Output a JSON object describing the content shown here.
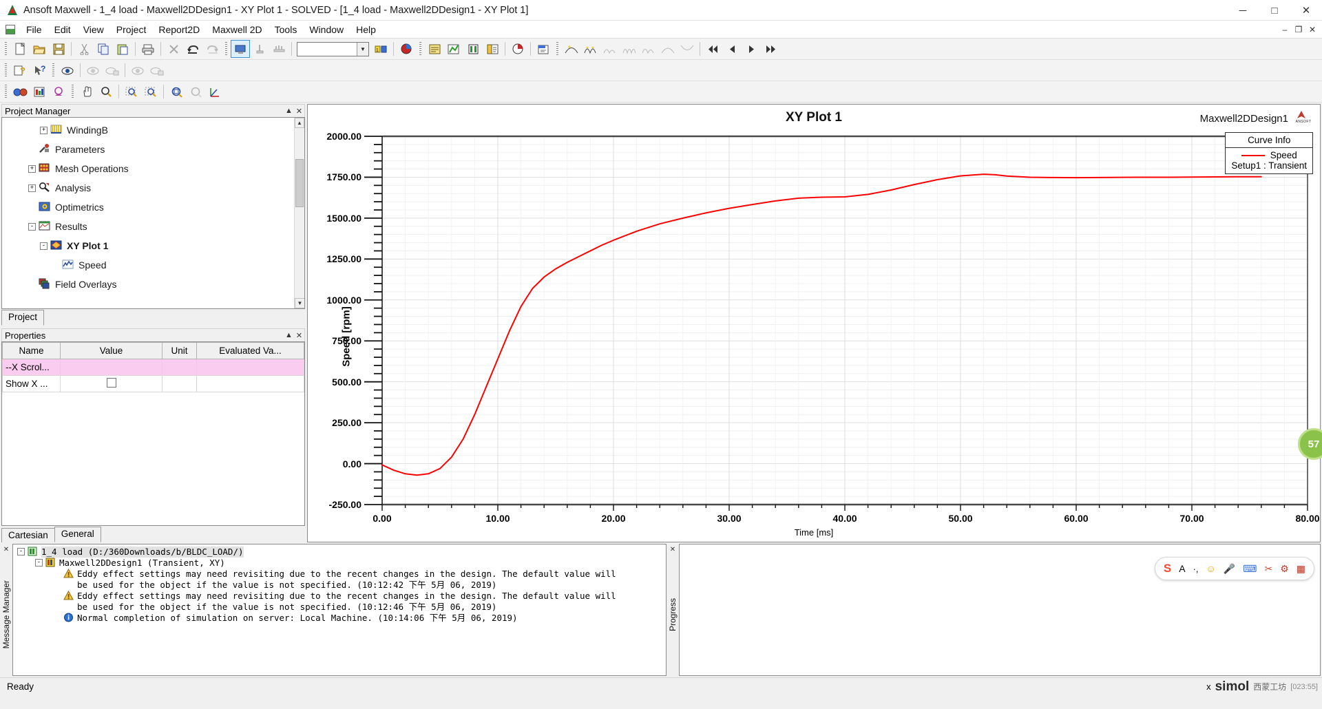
{
  "window": {
    "title": "Ansoft Maxwell  - 1_4 load - Maxwell2DDesign1 - XY Plot 1 - SOLVED - [1_4 load - Maxwell2DDesign1 - XY Plot 1]",
    "minimize": "─",
    "maximize": "□",
    "close": "✕",
    "mdi_minimize": "–",
    "mdi_restore": "❐",
    "mdi_close": "✕"
  },
  "menu": {
    "items": [
      "File",
      "Edit",
      "View",
      "Project",
      "Report2D",
      "Maxwell 2D",
      "Tools",
      "Window",
      "Help"
    ]
  },
  "toolbar": {
    "row1": [
      "new-icon",
      "open-icon",
      "save-icon",
      "cut-icon",
      "copy-icon",
      "paste-icon",
      "print-icon",
      "delete-icon",
      "undo-icon",
      "redo-icon",
      "desktop-icon",
      "validate-icon",
      "analyze-icon"
    ],
    "combo_value": "",
    "combo_arrow": "▼",
    "row1b": [
      "edit-sources-icon",
      "field-overlay-icon",
      "report-icon",
      "plot-icon",
      "animate-icon",
      "document-icon",
      "pie-icon",
      "export-icon"
    ],
    "row1c": [
      "curve1-icon",
      "curve2-icon",
      "curve3-icon",
      "curve4-icon",
      "curve5-icon",
      "curve6-icon",
      "curve7-icon"
    ],
    "nav": [
      "first-icon",
      "prev-icon",
      "next-icon",
      "last-icon"
    ],
    "row2": [
      "help-context-icon",
      "whats-this-icon",
      "show-all-icon",
      "hide-icon",
      "hide-all-icon",
      "show-icon",
      "show-selection-icon"
    ],
    "row3": [
      "render-icon",
      "color-icon",
      "target-icon",
      "pan-icon",
      "rotate-icon",
      "zoom-in-box-icon",
      "zoom-out-box-icon",
      "fit-all-icon",
      "fit-selection-icon",
      "axes-icon"
    ]
  },
  "project_manager": {
    "header": "Project Manager",
    "pin": "▲",
    "close": "✕",
    "tree": [
      {
        "label": "WindingB",
        "icon": "winding-icon",
        "expander": "+",
        "indent": 3,
        "bold": false
      },
      {
        "label": "Parameters",
        "icon": "parameters-icon",
        "expander": "",
        "indent": 2,
        "bold": false
      },
      {
        "label": "Mesh Operations",
        "icon": "mesh-icon",
        "expander": "+",
        "indent": 2,
        "bold": false
      },
      {
        "label": "Analysis",
        "icon": "analysis-icon",
        "expander": "+",
        "indent": 2,
        "bold": false
      },
      {
        "label": "Optimetrics",
        "icon": "optimetrics-icon",
        "expander": "",
        "indent": 2,
        "bold": false
      },
      {
        "label": "Results",
        "icon": "results-icon",
        "expander": "-",
        "indent": 2,
        "bold": false
      },
      {
        "label": "XY Plot 1",
        "icon": "xyplot-icon",
        "expander": "-",
        "indent": 3,
        "bold": true
      },
      {
        "label": "Speed",
        "icon": "trace-icon",
        "expander": "",
        "indent": 4,
        "bold": false
      },
      {
        "label": "Field Overlays",
        "icon": "overlays-icon",
        "expander": "",
        "indent": 2,
        "bold": false
      }
    ],
    "tabs": [
      {
        "label": "Project",
        "active": true
      }
    ]
  },
  "properties": {
    "header": "Properties",
    "pin": "▲",
    "close": "✕",
    "columns": [
      "Name",
      "Value",
      "Unit",
      "Evaluated Va..."
    ],
    "rows": [
      {
        "name": "--X Scrol...",
        "value": "",
        "unit": "",
        "evaluated": "",
        "selected": true,
        "checkbox": false
      },
      {
        "name": "Show X ...",
        "value": "",
        "unit": "",
        "evaluated": "",
        "selected": false,
        "checkbox": true
      }
    ],
    "tabs": [
      {
        "label": "Cartesian",
        "active": false
      },
      {
        "label": "General",
        "active": true
      }
    ]
  },
  "chart_data": {
    "type": "line",
    "title": "XY Plot 1",
    "design_name": "Maxwell2DDesign1",
    "logo_text": "ANSOFT",
    "xlabel": "Time [ms]",
    "ylabel": "Speed [rpm]",
    "xlim": [
      0,
      80
    ],
    "ylim": [
      -250,
      2000
    ],
    "xticks": [
      "0.00",
      "10.00",
      "20.00",
      "30.00",
      "40.00",
      "50.00",
      "60.00",
      "70.00",
      "80.00"
    ],
    "yticks": [
      "2000.00",
      "1750.00",
      "1500.00",
      "1250.00",
      "1000.00",
      "750.00",
      "500.00",
      "250.00",
      "0.00",
      "-250.00"
    ],
    "grid": true,
    "minor_ticks_per_interval": 5,
    "legend": {
      "title": "Curve Info",
      "entries": [
        {
          "name": "Speed",
          "sub": "Setup1 : Transient",
          "color": "#ff0000"
        }
      ]
    },
    "series": [
      {
        "name": "Speed",
        "color": "#ff0000",
        "x": [
          0,
          1,
          2,
          3,
          4,
          5,
          6,
          7,
          8,
          9,
          10,
          11,
          12,
          13,
          14,
          15,
          16,
          17,
          18,
          19,
          20,
          22,
          24,
          26,
          28,
          30,
          32,
          34,
          36,
          38,
          40,
          42,
          44,
          46,
          48,
          50,
          52,
          53,
          54,
          56,
          58,
          60,
          62,
          64,
          66,
          68,
          70,
          72,
          74,
          76
        ],
        "y": [
          -8,
          -40,
          -62,
          -70,
          -62,
          -30,
          40,
          150,
          300,
          470,
          640,
          810,
          960,
          1070,
          1140,
          1190,
          1230,
          1265,
          1300,
          1335,
          1365,
          1420,
          1465,
          1500,
          1532,
          1560,
          1583,
          1605,
          1622,
          1628,
          1630,
          1645,
          1672,
          1705,
          1735,
          1758,
          1768,
          1765,
          1757,
          1750,
          1748,
          1747,
          1748,
          1749,
          1750,
          1750,
          1751,
          1752,
          1753,
          1753
        ]
      }
    ]
  },
  "message_manager": {
    "dock_label": "Message Manager",
    "close": "✕",
    "rows": [
      {
        "indent": 0,
        "expander": "-",
        "icon": "project-icon",
        "text": "1_4 load (D:/360Downloads/b/BLDC_LOAD/)",
        "highlight": true,
        "text2": ""
      },
      {
        "indent": 1,
        "expander": "-",
        "icon": "design-icon",
        "text": "Maxwell2DDesign1 (Transient, XY)",
        "highlight": false,
        "text2": ""
      },
      {
        "indent": 2,
        "expander": "",
        "icon": "warning-icon",
        "text": "Eddy effect settings may need revisiting due to the recent changes in the design.  The default value will",
        "text2": "be used for the object if the value is not specified.  (10:12:42 下午  5月 06, 2019)",
        "highlight": false
      },
      {
        "indent": 2,
        "expander": "",
        "icon": "warning-icon",
        "text": "Eddy effect settings may need revisiting due to the recent changes in the design.  The default value will",
        "text2": "be used for the object if the value is not specified.  (10:12:46 下午  5月 06, 2019)",
        "highlight": false
      },
      {
        "indent": 2,
        "expander": "",
        "icon": "info-icon",
        "text": "Normal completion of simulation on server: Local Machine. (10:14:06 下午  5月 06, 2019)",
        "text2": "",
        "highlight": false
      }
    ]
  },
  "progress": {
    "dock_label": "Progress",
    "close": "✕"
  },
  "ime": {
    "logo": "S",
    "items": [
      "mode-a-icon",
      "punctuation-icon",
      "emoji-icon",
      "voice-icon",
      "keyboard-icon",
      "tools-icon",
      "apps-icon",
      "grid-icon"
    ]
  },
  "statusbar": {
    "ready": "Ready",
    "close_mark": "x",
    "watermark": "simol",
    "watermark2": "西蒙工坊",
    "coords": "[023:55]"
  },
  "float_badge": {
    "text": "57"
  },
  "colors": {
    "trace": "#ff0000",
    "selection": "#f9ccf0",
    "panel": "#f0f0f0",
    "accent": "#3c8fd4"
  }
}
